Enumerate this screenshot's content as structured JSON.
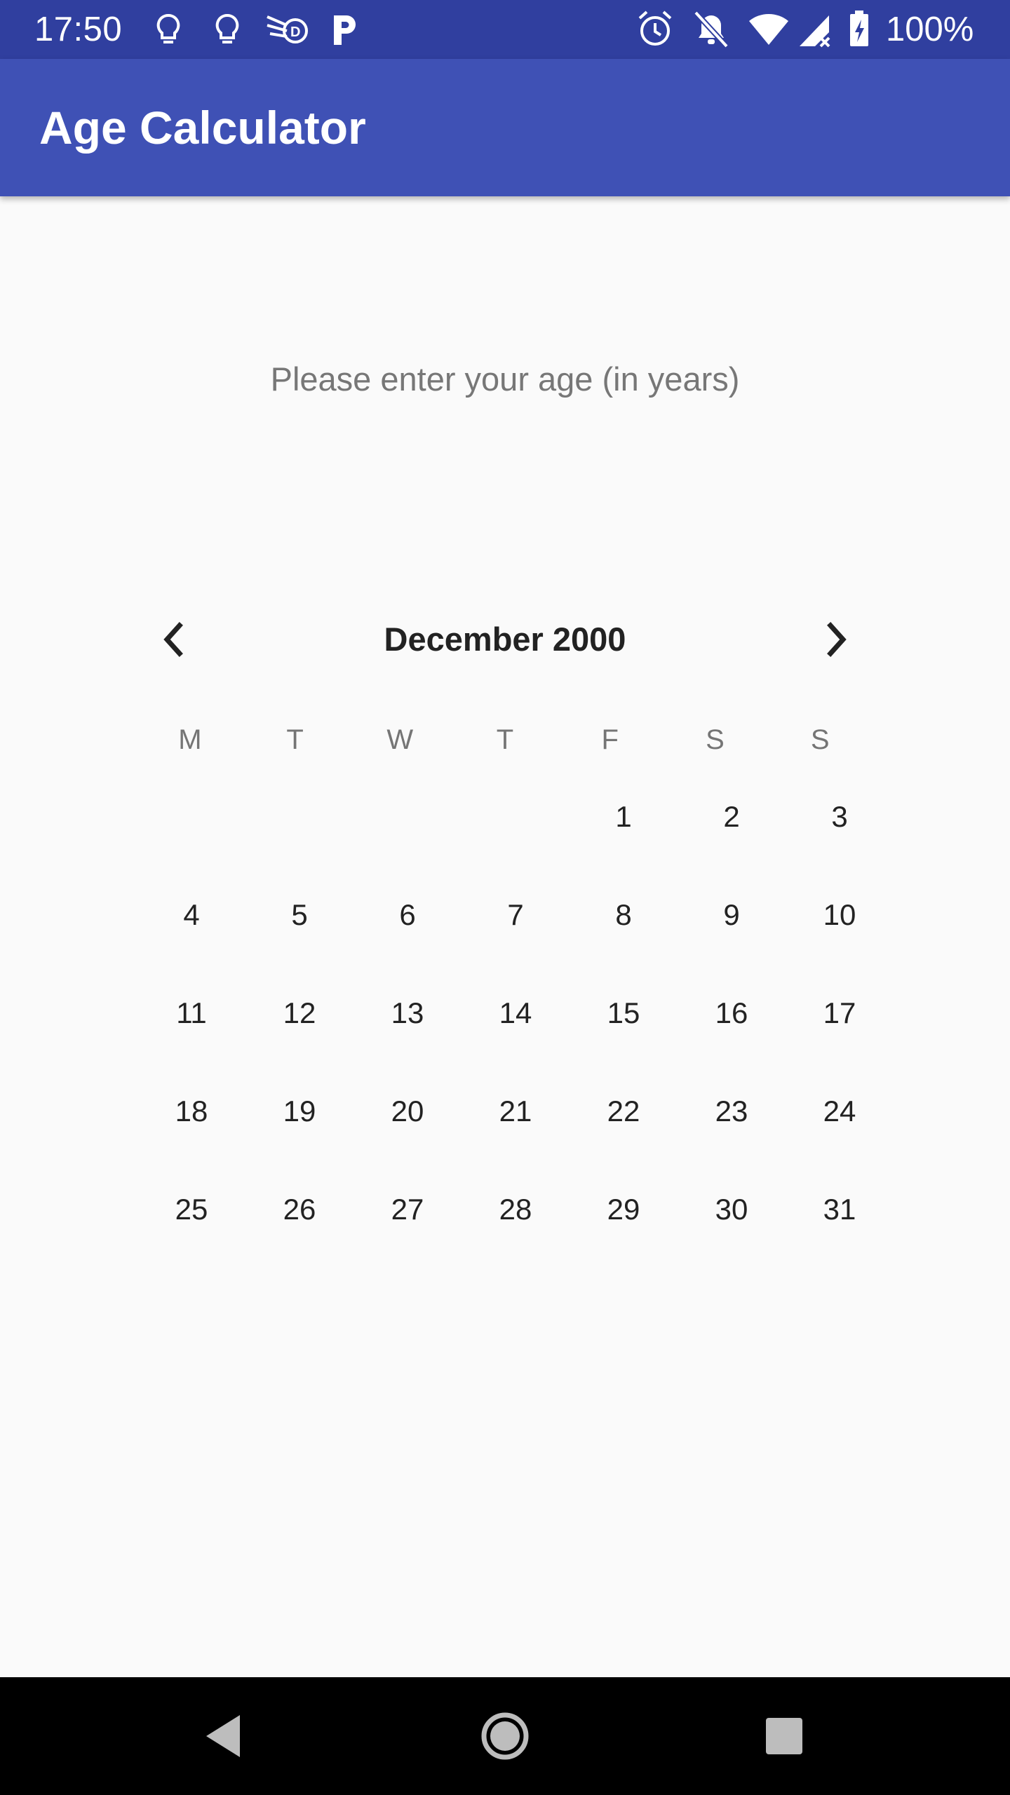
{
  "status_bar": {
    "time": "17:50",
    "battery": "100%",
    "icons_left": [
      "lightbulb-icon",
      "lightbulb-icon",
      "speed-app-icon",
      "parking-app-icon"
    ],
    "icons_right": [
      "alarm-icon",
      "notifications-off-icon",
      "wifi-icon",
      "signal-icon",
      "battery-charging-icon"
    ]
  },
  "app_bar": {
    "title": "Age Calculator"
  },
  "age_input": {
    "placeholder": "Please enter your age (in years)",
    "value": ""
  },
  "calendar": {
    "month_title": "December 2000",
    "weekdays": [
      "M",
      "T",
      "W",
      "T",
      "F",
      "S",
      "S"
    ],
    "leading_blanks": 4,
    "days": [
      "1",
      "2",
      "3",
      "4",
      "5",
      "6",
      "7",
      "8",
      "9",
      "10",
      "11",
      "12",
      "13",
      "14",
      "15",
      "16",
      "17",
      "18",
      "19",
      "20",
      "21",
      "22",
      "23",
      "24",
      "25",
      "26",
      "27",
      "28",
      "29",
      "30",
      "31"
    ]
  },
  "colors": {
    "status_bar": "#303f9f",
    "app_bar": "#3f51b5",
    "background": "#fafafa",
    "nav_bar": "#000000"
  }
}
